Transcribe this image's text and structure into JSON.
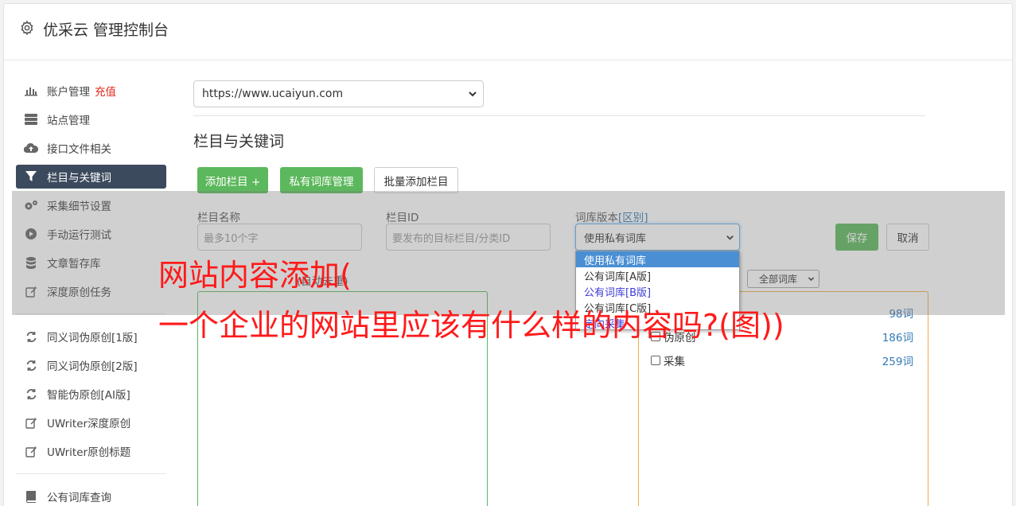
{
  "app": {
    "title": "优采云 管理控制台",
    "icon": "gear-icon"
  },
  "sidebar": {
    "items": [
      {
        "label": "账户管理",
        "badge": "充值",
        "icon": "bar-chart-icon"
      },
      {
        "label": "站点管理",
        "icon": "server-icon"
      },
      {
        "label": "接口文件相关",
        "icon": "cloud-upload-icon"
      },
      {
        "label": "栏目与关键词",
        "icon": "filter-icon",
        "active": true
      },
      {
        "label": "采集细节设置",
        "icon": "cogs-icon"
      },
      {
        "label": "手动运行测试",
        "icon": "play-icon"
      },
      {
        "label": "文章暂存库",
        "icon": "database-icon"
      },
      {
        "label": "深度原创任务",
        "icon": "edit-icon"
      },
      {
        "label": "同义词伪原创[1版]",
        "icon": "refresh-icon"
      },
      {
        "label": "同义词伪原创[2版]",
        "icon": "refresh-icon"
      },
      {
        "label": "智能伪原创[AI版]",
        "icon": "refresh-icon"
      },
      {
        "label": "UWriter深度原创",
        "icon": "edit-icon"
      },
      {
        "label": "UWriter原创标题",
        "icon": "edit-icon"
      },
      {
        "label": "公有词库查询",
        "icon": "book-icon"
      }
    ]
  },
  "main": {
    "site_select": "https://www.ucaiyun.com",
    "section_title": "栏目与关键词",
    "buttons": {
      "add_column": "添加栏目 +",
      "private_lib": "私有词库管理",
      "batch_add": "批量添加栏目"
    },
    "form": {
      "name_label": "栏目名称",
      "name_placeholder": "最多10个字",
      "id_label": "栏目ID",
      "id_placeholder": "要发布的目标栏目/分类ID",
      "lib_label": "词库版本",
      "lib_label_link": "[区别]",
      "lib_selected": "使用私有词库",
      "save": "保存",
      "cancel": "取消"
    },
    "dropdown_options": [
      "使用私有词库",
      "公有词库[A版]",
      "公有词库[B版]",
      "公有词库[C版]",
      "定向采集"
    ],
    "keywords_label": "(自动去重)",
    "all_lib_select": "全部词库",
    "lib_list": [
      {
        "name": "",
        "count": "98词"
      },
      {
        "name": "伪原创",
        "count": "186词"
      },
      {
        "name": "采集",
        "count": "259词"
      }
    ]
  },
  "watermark": {
    "line1": "网站内容添加(",
    "line2": "一个企业的网站里应该有什么样的内容吗?(图))"
  }
}
